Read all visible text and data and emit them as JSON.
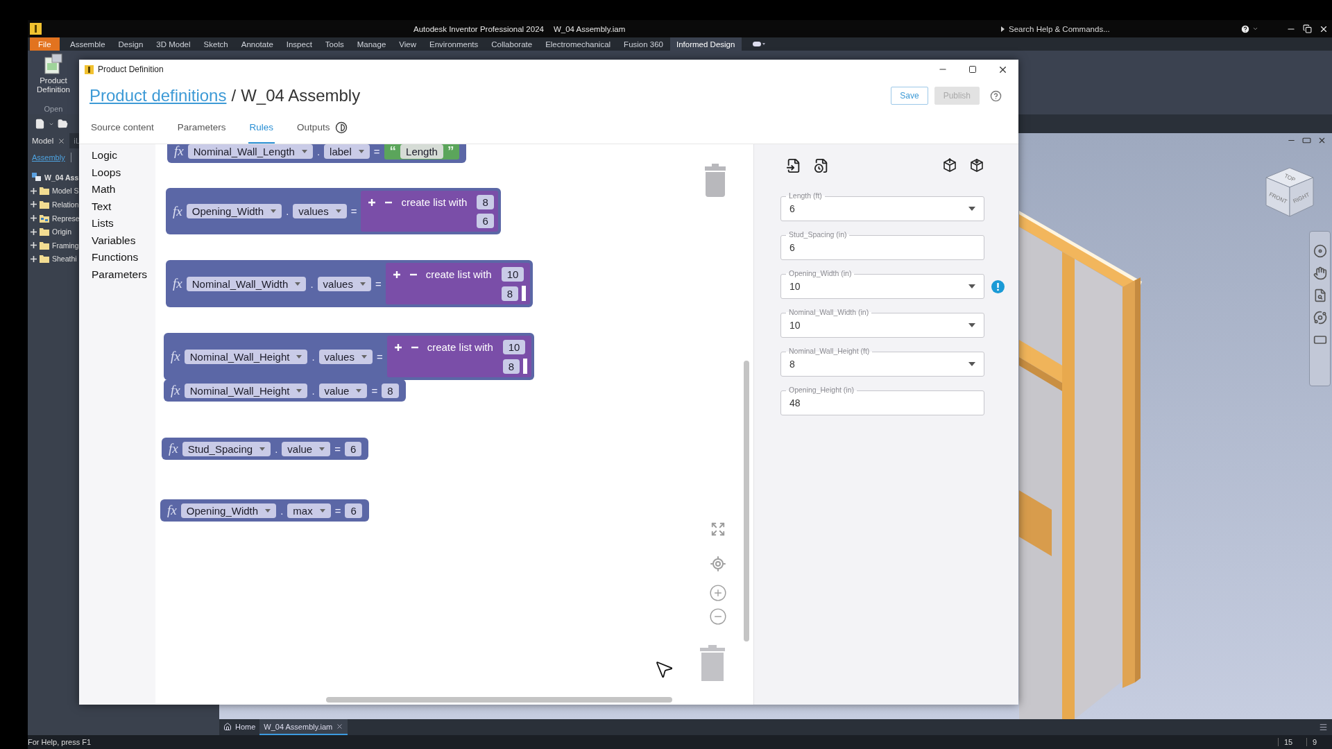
{
  "app": {
    "title": "Autodesk Inventor Professional 2024",
    "document": "W_04 Assembly.iam",
    "search_placeholder": "Search Help & Commands..."
  },
  "ribbon": {
    "file_tab": "File",
    "tabs": [
      {
        "label": "Assemble",
        "selected": false
      },
      {
        "label": "Design",
        "selected": false
      },
      {
        "label": "3D Model",
        "selected": false
      },
      {
        "label": "Sketch",
        "selected": false
      },
      {
        "label": "Annotate",
        "selected": false
      },
      {
        "label": "Inspect",
        "selected": false
      },
      {
        "label": "Tools",
        "selected": false
      },
      {
        "label": "Manage",
        "selected": false
      },
      {
        "label": "View",
        "selected": false
      },
      {
        "label": "Environments",
        "selected": false
      },
      {
        "label": "Collaborate",
        "selected": false
      },
      {
        "label": "Electromechanical",
        "selected": false
      },
      {
        "label": "Fusion 360",
        "selected": false
      },
      {
        "label": "Informed Design",
        "selected": true
      }
    ],
    "button": "Product Definition",
    "panel_label": "Open"
  },
  "browser": {
    "tabs": [
      {
        "label": "Model",
        "selected": true
      },
      {
        "label": "iL",
        "selected": false
      }
    ],
    "view": "Assembly",
    "tree": [
      {
        "label": "W_04 Ass",
        "kind": "assembly",
        "children": [
          {
            "label": "Model S",
            "kind": "folder",
            "expanded": false
          },
          {
            "label": "Relation",
            "kind": "folder",
            "expanded": false
          },
          {
            "label": "Represe",
            "kind": "representation",
            "expanded": false
          },
          {
            "label": "Origin",
            "kind": "folder",
            "expanded": false
          },
          {
            "label": "Framing",
            "kind": "folder",
            "expanded": false
          },
          {
            "label": "Sheathi",
            "kind": "folder",
            "expanded": false
          }
        ]
      }
    ]
  },
  "dialog": {
    "title": "Product Definition",
    "breadcrumb": {
      "link": "Product definitions",
      "separator": "/",
      "current": "W_04 Assembly"
    },
    "buttons": [
      {
        "label": "Save",
        "disabled": false
      },
      {
        "label": "Publish",
        "disabled": true
      }
    ],
    "tabs": [
      {
        "label": "Source content",
        "kind": "plain",
        "selected": false
      },
      {
        "label": "Parameters",
        "kind": "plain",
        "selected": false
      },
      {
        "label": "Rules",
        "kind": "plain",
        "selected": true
      },
      {
        "label": "Outputs",
        "kind": "indicator",
        "selected": false
      }
    ],
    "categories": [
      "Logic",
      "Loops",
      "Math",
      "Text",
      "Lists",
      "Variables",
      "Functions",
      "Parameters"
    ],
    "blocks": [
      {
        "symbol": "fx",
        "parameter": "Nominal_Wall_Length",
        "separator": ".",
        "property": "label",
        "operator": "=",
        "value": {
          "kind": "text",
          "open_quote": "“",
          "text": "Length",
          "close_quote": "”"
        }
      },
      {
        "symbol": "fx",
        "parameter": "Opening_Width",
        "separator": ".",
        "property": "values",
        "operator": "=",
        "value": {
          "kind": "list",
          "label": "create list with",
          "items": [
            "8",
            "6"
          ],
          "open_slot": false
        }
      },
      {
        "symbol": "fx",
        "parameter": "Nominal_Wall_Width",
        "separator": ".",
        "property": "values",
        "operator": "=",
        "value": {
          "kind": "list",
          "label": "create list with",
          "items": [
            "10",
            "8"
          ],
          "open_slot": true
        }
      },
      {
        "symbol": "fx",
        "parameter": "Nominal_Wall_Height",
        "separator": ".",
        "property": "values",
        "operator": "=",
        "value": {
          "kind": "list",
          "label": "create list with",
          "items": [
            "10",
            "8"
          ],
          "open_slot": true
        }
      },
      {
        "symbol": "fx",
        "parameter": "Nominal_Wall_Height",
        "separator": ".",
        "property": "value",
        "operator": "=",
        "value": {
          "kind": "number",
          "text": "8"
        }
      },
      {
        "symbol": "fx",
        "parameter": "Stud_Spacing",
        "separator": ".",
        "property": "value",
        "operator": "=",
        "value": {
          "kind": "number",
          "text": "6"
        }
      },
      {
        "symbol": "fx",
        "parameter": "Opening_Width",
        "separator": ".",
        "property": "max",
        "operator": "=",
        "value": {
          "kind": "number",
          "text": "6"
        }
      }
    ],
    "panel": {
      "fields": [
        {
          "label": "Length (ft)",
          "value": "6",
          "kind": "dropdown",
          "alert": false
        },
        {
          "label": "Stud_Spacing (in)",
          "value": "6",
          "kind": "text",
          "alert": false
        },
        {
          "label": "Opening_Width (in)",
          "value": "10",
          "kind": "dropdown",
          "alert": true
        },
        {
          "label": "Nominal_Wall_Width (in)",
          "value": "10",
          "kind": "dropdown",
          "alert": false
        },
        {
          "label": "Nominal_Wall_Height (ft)",
          "value": "8",
          "kind": "dropdown",
          "alert": false
        },
        {
          "label": "Opening_Height (in)",
          "value": "48",
          "kind": "text",
          "alert": false
        }
      ]
    }
  },
  "viewport": {
    "view_cube": {
      "faces": [
        "TOP",
        "FRONT",
        "RIGHT"
      ]
    }
  },
  "document_tabs": [
    {
      "label": "Home",
      "kind": "home",
      "selected": false
    },
    {
      "label": "W_04 Assembly.iam",
      "kind": "document",
      "selected": true
    }
  ],
  "status_bar": {
    "message": "For Help, press F1",
    "fields": [
      "15",
      "9"
    ]
  }
}
